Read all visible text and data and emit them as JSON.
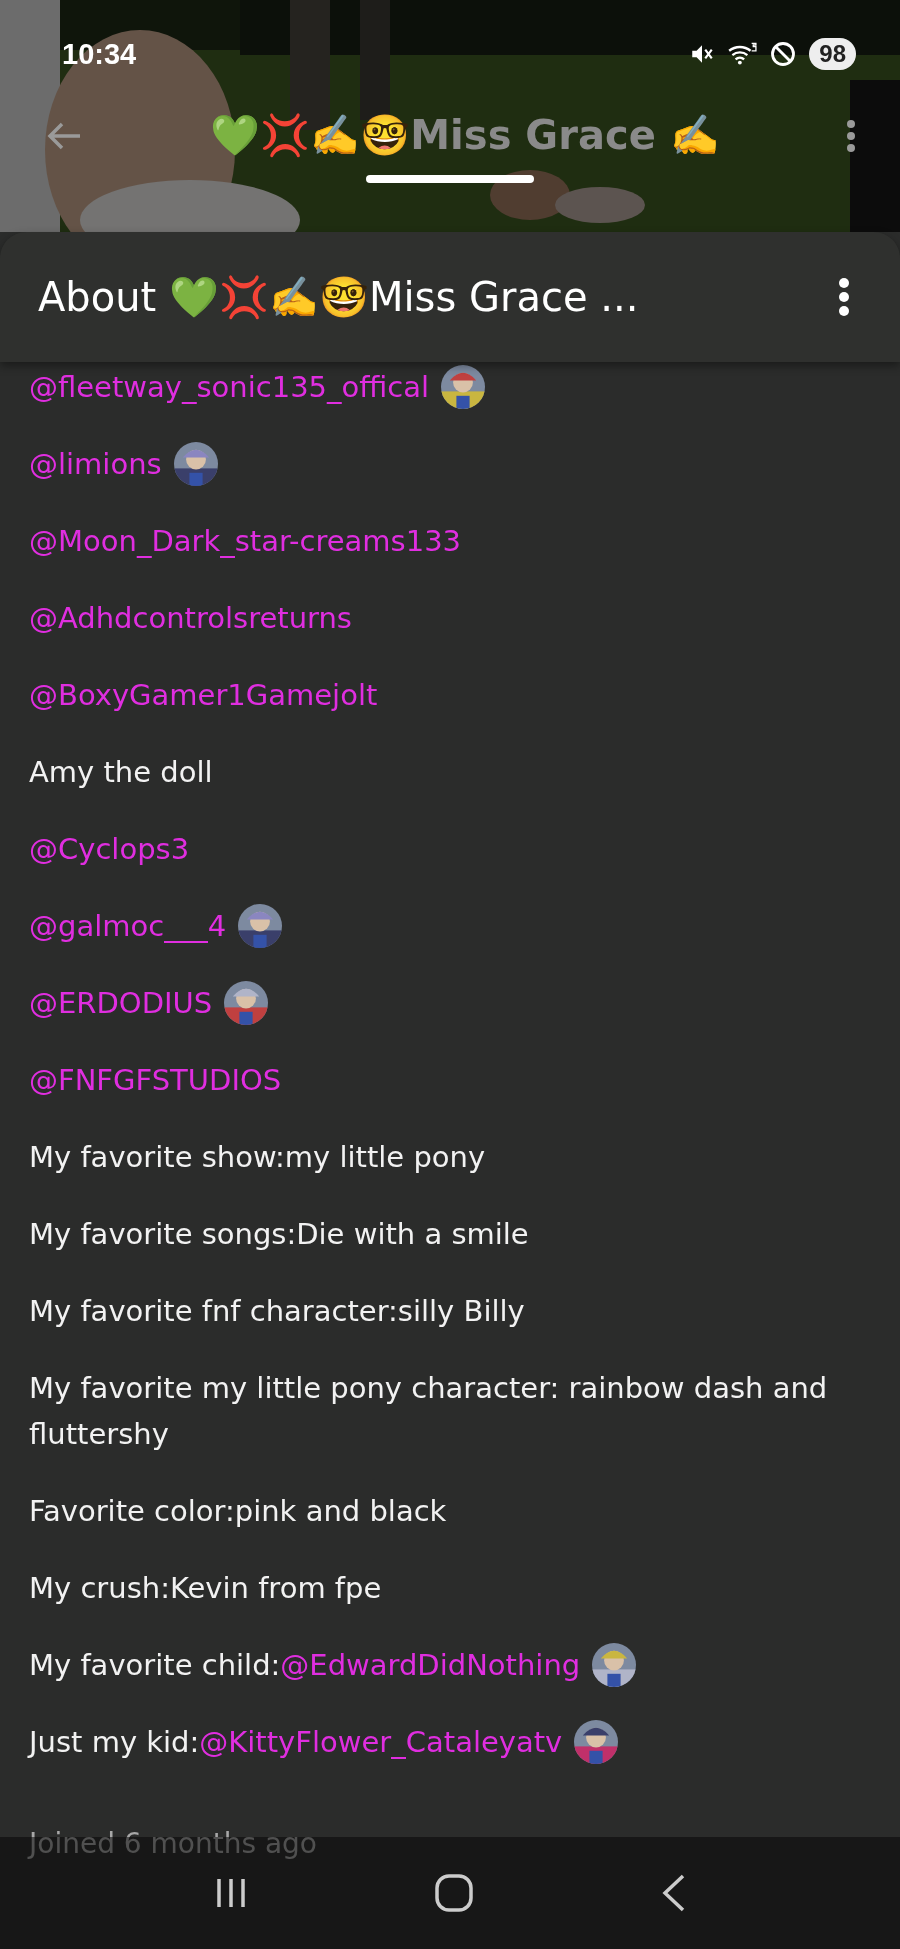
{
  "status_bar": {
    "time": "10:34",
    "battery": "98"
  },
  "toolbar": {
    "title": "💚💢✍️🤓Miss Grace ✍️"
  },
  "sheet": {
    "title": "About 💚💢✍️🤓Miss Grace ..."
  },
  "lines": [
    {
      "mention": "@fleetway_sonic135_offical",
      "avatar": true
    },
    {
      "mention": "@limions",
      "avatar": true
    },
    {
      "mention": "@Moon_Dark_star-creams133",
      "avatar": false
    },
    {
      "mention": "@Adhdcontrolsreturns",
      "avatar": false
    },
    {
      "mention": "@BoxyGamer1Gamejolt",
      "avatar": false
    },
    {
      "text": "Amy the doll",
      "avatar": false
    },
    {
      "mention": "@Cyclops3",
      "avatar": false
    },
    {
      "mention": "@galmoc___4",
      "avatar": true
    },
    {
      "mention": "@ERDODIUS",
      "avatar": true
    },
    {
      "mention": "@FNFGFSTUDIOS",
      "avatar": false
    },
    {
      "text": "My favorite show:my little pony",
      "avatar": false
    },
    {
      "text": "My favorite songs:Die with a smile",
      "avatar": false
    },
    {
      "text": "My favorite fnf character:silly Billy",
      "avatar": false
    },
    {
      "text": "My favorite my little pony character: rainbow dash and fluttershy",
      "avatar": false
    },
    {
      "text": "Favorite color:pink and black",
      "avatar": false
    },
    {
      "text": "My crush:Kevin from fpe",
      "avatar": false
    },
    {
      "text": "My favorite child:",
      "mention": "@EdwardDidNothing",
      "avatar": true
    },
    {
      "text": "Just my kid:",
      "mention": "@KittyFlower_Cataleyatv",
      "avatar": true
    }
  ],
  "footer": {
    "joined": "Joined 6 months ago"
  }
}
